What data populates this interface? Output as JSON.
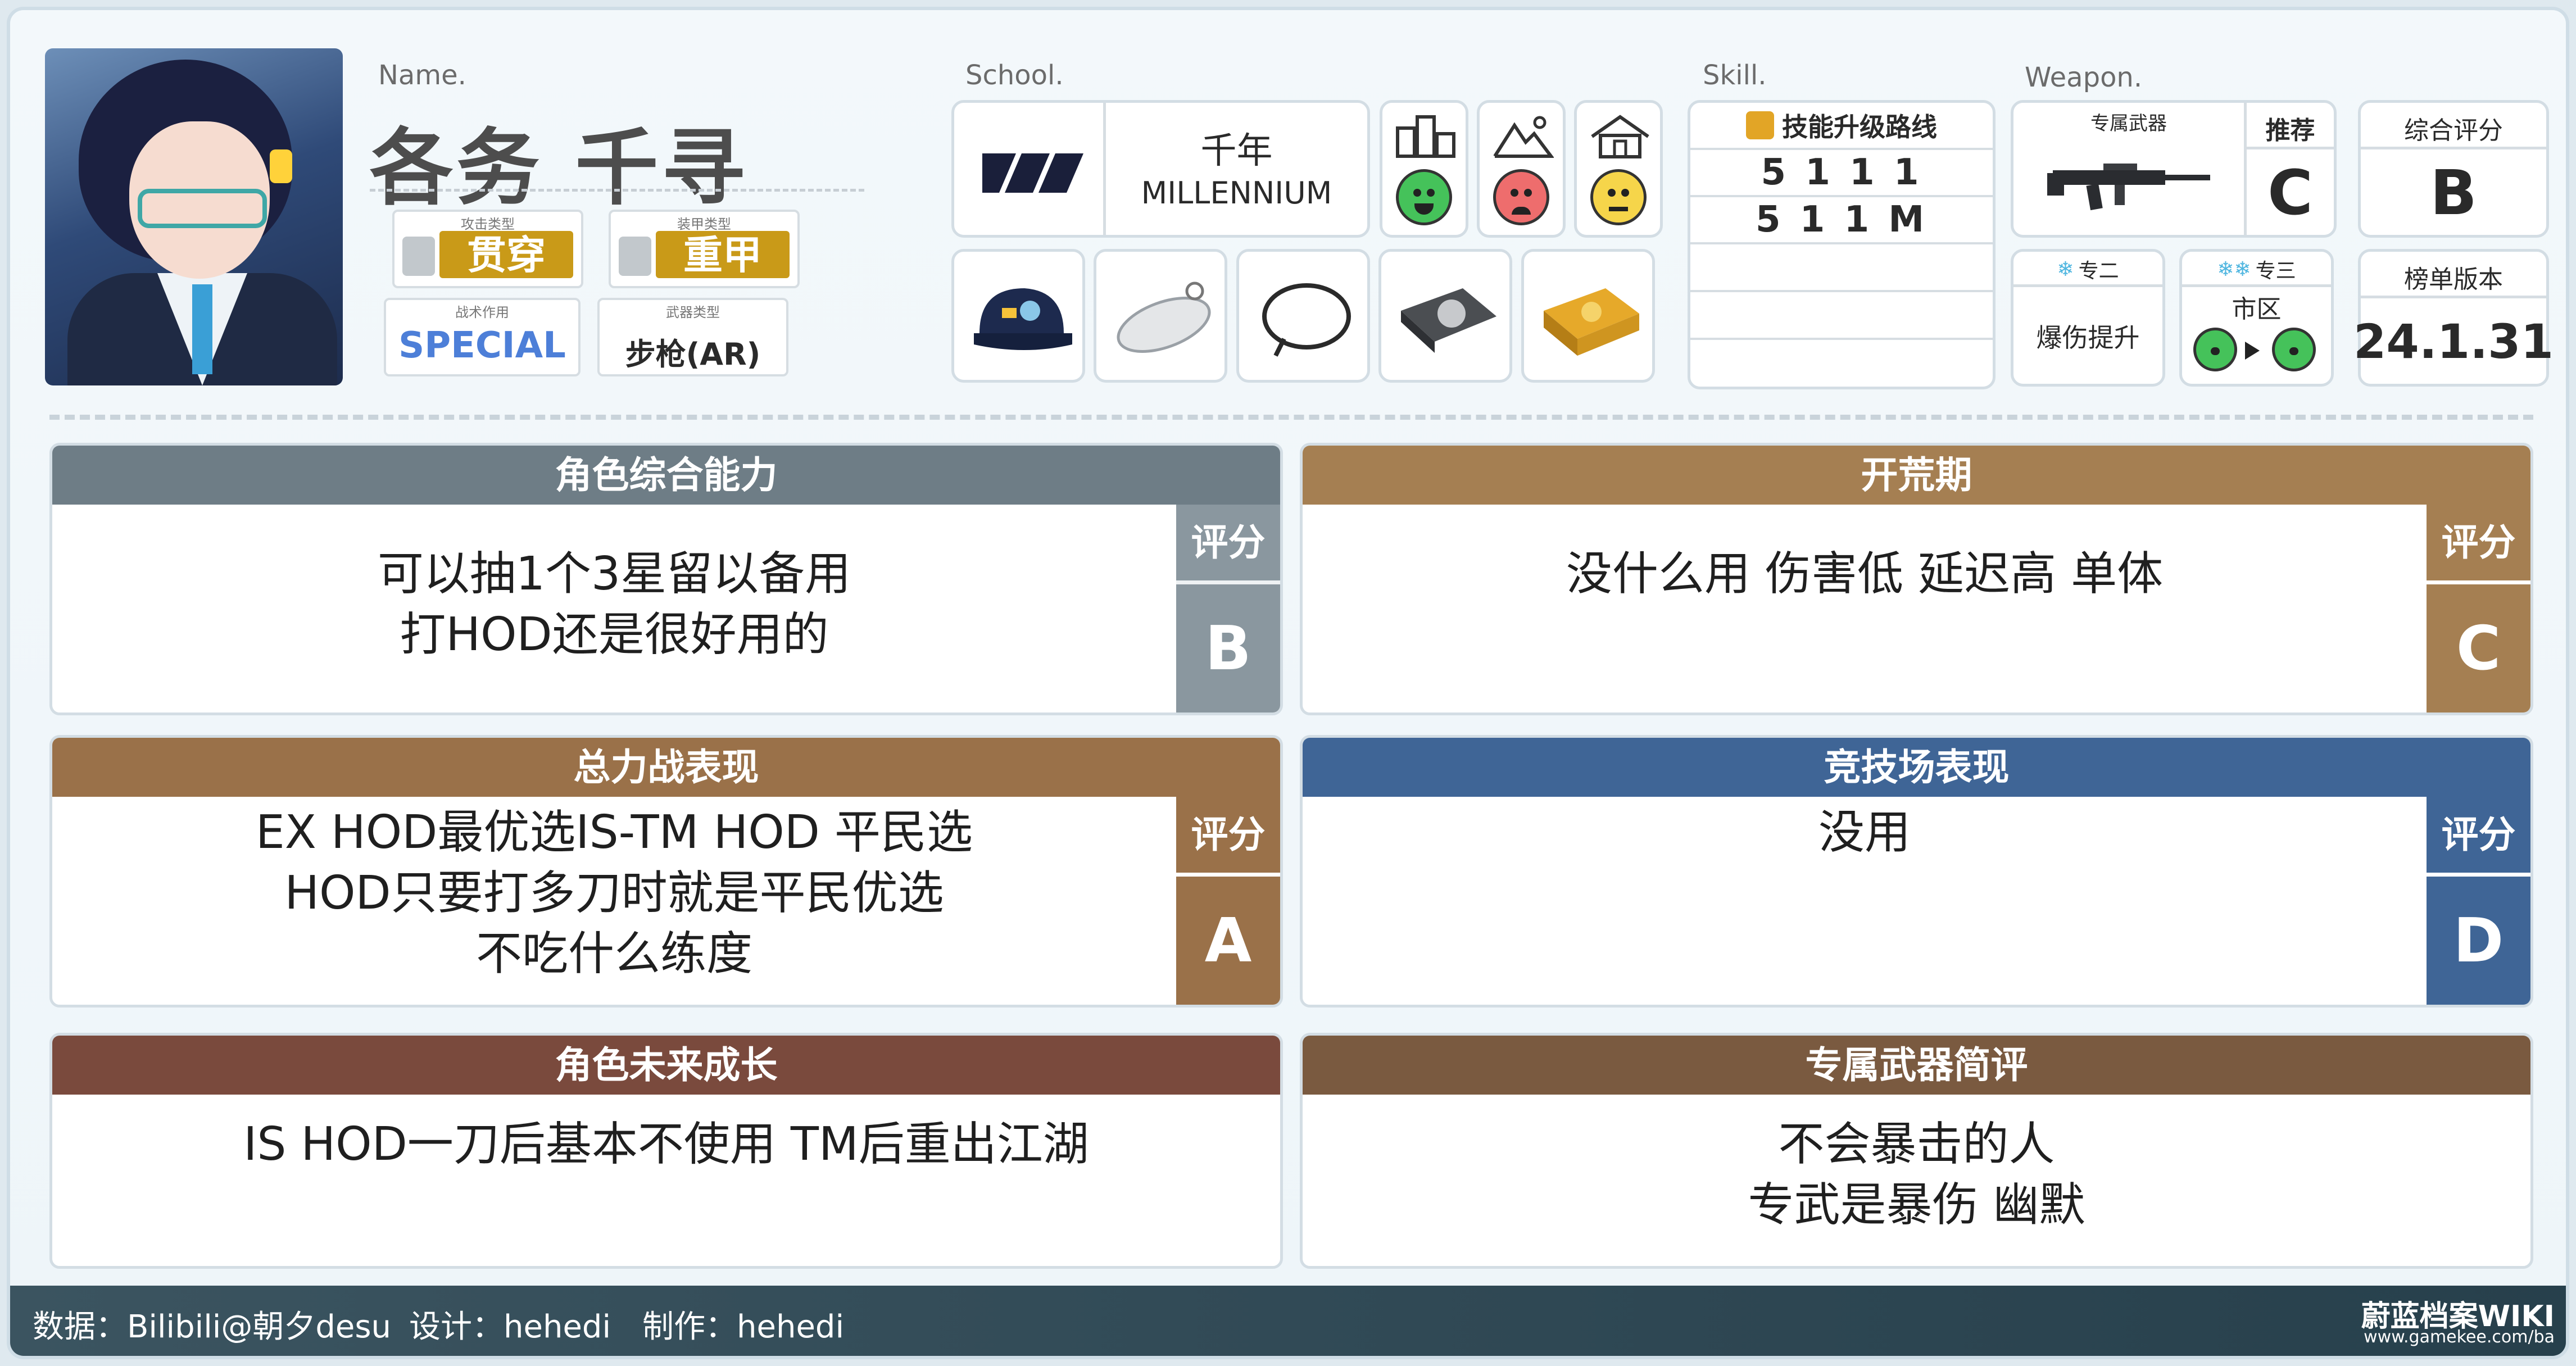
{
  "header": {
    "labels": {
      "name": "Name.",
      "school": "School.",
      "skill": "Skill.",
      "weapon": "Weapon."
    },
    "character_name": "各务 千寻",
    "tags": {
      "attack_type_label": "攻击类型",
      "attack_type": "贯穿",
      "armor_type_label": "装甲类型",
      "armor_type": "重甲",
      "tactical_role_label": "战术作用",
      "tactical_role": "SPECIAL",
      "weapon_type_label": "武器类型",
      "weapon_type": "步枪(AR)"
    },
    "school": {
      "name_cn": "千年",
      "name_en": "MILLENNIUM"
    },
    "terrain": [
      {
        "icon": "city-icon",
        "mood": "green"
      },
      {
        "icon": "outdoor-icon",
        "mood": "red"
      },
      {
        "icon": "indoor-icon",
        "mood": "yellow"
      }
    ],
    "gifts": [
      "cap-icon",
      "servant-keychain-icon",
      "necklace-icon",
      "hard-drive-icon",
      "gold-box-icon"
    ],
    "skill": {
      "title": "技能升级路线",
      "rows": [
        "5 1 1 1",
        "5 1 1 M",
        "",
        "",
        ""
      ]
    },
    "weapon": {
      "exclusive_label": "专属武器",
      "recommend_label": "推荐",
      "recommend_grade": "C",
      "overall_label": "综合评分",
      "overall_grade": "B",
      "star2_label": "专二",
      "star2_value": "爆伤提升",
      "star3_label": "专三",
      "star3_value": "市区",
      "version_label": "榜单版本",
      "version": "24.1.31"
    }
  },
  "panels": [
    {
      "id": "overall",
      "title": "角色综合能力",
      "lines": [
        "可以抽1个3星留以备用",
        "打HOD还是很好用的"
      ],
      "grade_label": "评分",
      "grade": "B",
      "color": "#6e7d86"
    },
    {
      "id": "early",
      "title": "开荒期",
      "lines": [
        "没什么用 伤害低 延迟高 单体"
      ],
      "grade_label": "评分",
      "grade": "C",
      "color": "#a57f52"
    },
    {
      "id": "raid",
      "title": "总力战表现",
      "lines": [
        "EX HOD最优选IS-TM HOD 平民选",
        "HOD只要打多刀时就是平民优选",
        "不吃什么练度"
      ],
      "grade_label": "评分",
      "grade": "A",
      "color": "#9a7149"
    },
    {
      "id": "arena",
      "title": "竞技场表现",
      "lines": [
        "没用"
      ],
      "grade_label": "评分",
      "grade": "D",
      "color": "#3f6596"
    },
    {
      "id": "future",
      "title": "角色未来成长",
      "lines": [
        "IS HOD一刀后基本不使用 TM后重出江湖"
      ],
      "color": "#7a4a3d"
    },
    {
      "id": "weapon",
      "title": "专属武器简评",
      "lines": [
        "不会暴击的人",
        "专武是暴伤 幽默"
      ],
      "color": "#7a5a40"
    }
  ],
  "footer": {
    "data": "数据：Bilibili@朝夕desu",
    "design": "设计：hehedi",
    "made": "制作：hehedi",
    "brand": "蔚蓝档案WIKI",
    "site": "www.gamekee.com/ba"
  }
}
